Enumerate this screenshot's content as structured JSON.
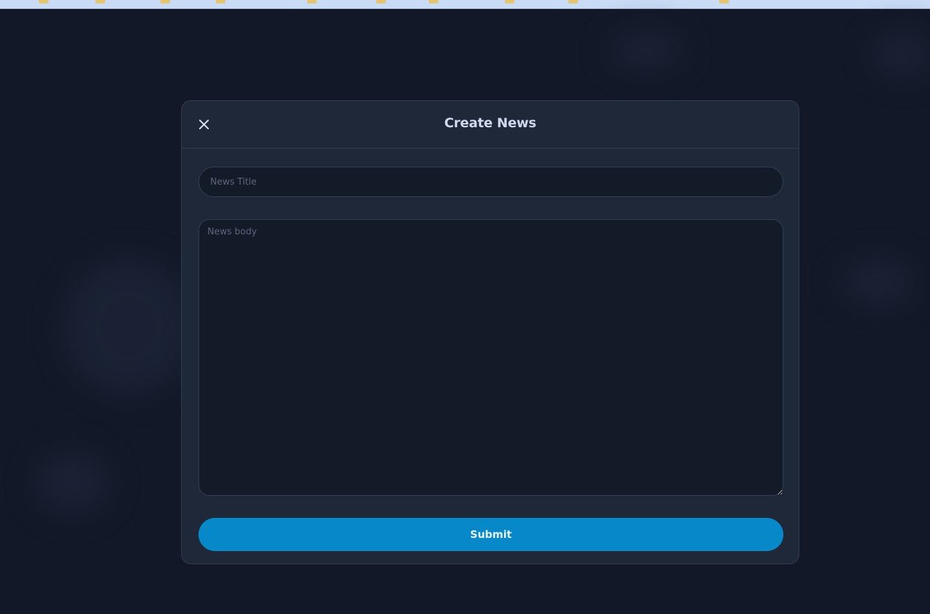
{
  "modal": {
    "title": "Create News",
    "close_icon": "close-icon",
    "title_field": {
      "value": "",
      "placeholder": "News Title"
    },
    "body_field": {
      "value": "",
      "placeholder": "News body"
    },
    "submit_label": "Submit"
  },
  "colors": {
    "page_background": "#121827",
    "modal_background": "#1f2838",
    "input_background": "#131a28",
    "accent": "#0788c9",
    "title_text": "#cdd9ee",
    "placeholder_text": "#5d6779"
  }
}
